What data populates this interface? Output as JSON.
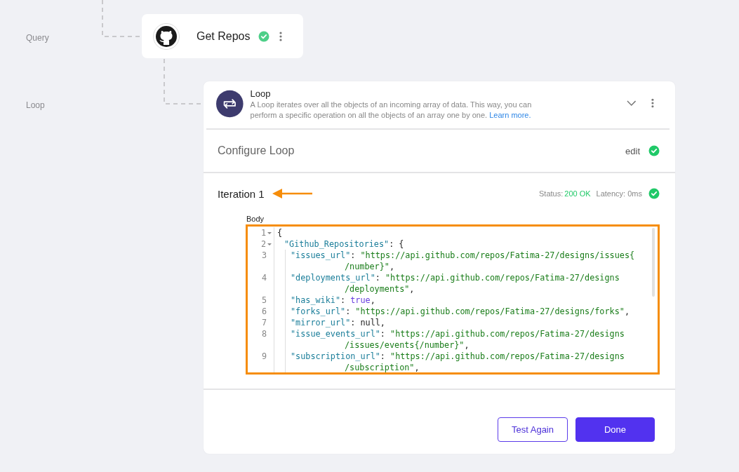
{
  "canvas": {
    "stage_labels": [
      "Query",
      "Loop"
    ]
  },
  "query_node": {
    "title": "Get Repos",
    "success": true
  },
  "loop_panel": {
    "title": "Loop",
    "description": "A Loop iterates over all the objects of an incoming array of data. This way, you can perform a specific operation on all the objects of an array one by one.",
    "link": "Learn more.",
    "configure": {
      "title": "Configure Loop",
      "action": "edit",
      "success": true
    },
    "iteration": {
      "title": "Iteration 1",
      "status_label": "Status:",
      "status_value": "200 OK",
      "latency": "Latency: 0ms",
      "success": true,
      "highlighted": true,
      "body_label": "Body",
      "code": [
        {
          "number": "1",
          "folded": false,
          "tokens": [
            {
              "kind": "punct",
              "text": "{"
            }
          ],
          "children": [
            {
              "number": "2",
              "folded": false,
              "tokens": [
                {
                  "kind": "key",
                  "text": "\"Github_Repositories\""
                },
                {
                  "kind": "punct",
                  "text": ": {"
                }
              ],
              "children": [
                {
                  "number": "3",
                  "tokens": [
                    {
                      "kind": "key",
                      "text": "\"issues_url\""
                    },
                    {
                      "kind": "punct",
                      "text": ": "
                    },
                    {
                      "kind": "string",
                      "text": "\"https://api.github.com/repos/Fatima-27/designs/issues{"
                    }
                  ],
                  "wrap": [
                    {
                      "kind": "string",
                      "text": "/number}\""
                    },
                    {
                      "kind": "punct",
                      "text": ","
                    }
                  ]
                },
                {
                  "number": "4",
                  "tokens": [
                    {
                      "kind": "key",
                      "text": "\"deployments_url\""
                    },
                    {
                      "kind": "punct",
                      "text": ": "
                    },
                    {
                      "kind": "string",
                      "text": "\"https://api.github.com/repos/Fatima-27/designs"
                    }
                  ],
                  "wrap": [
                    {
                      "kind": "string",
                      "text": "/deployments\""
                    },
                    {
                      "kind": "punct",
                      "text": ","
                    }
                  ]
                },
                {
                  "number": "5",
                  "tokens": [
                    {
                      "kind": "key",
                      "text": "\"has_wiki\""
                    },
                    {
                      "kind": "punct",
                      "text": ": "
                    },
                    {
                      "kind": "keyword",
                      "text": "true"
                    },
                    {
                      "kind": "punct",
                      "text": ","
                    }
                  ]
                },
                {
                  "number": "6",
                  "tokens": [
                    {
                      "kind": "key",
                      "text": "\"forks_url\""
                    },
                    {
                      "kind": "punct",
                      "text": ": "
                    },
                    {
                      "kind": "string",
                      "text": "\"https://api.github.com/repos/Fatima-27/designs/forks\""
                    },
                    {
                      "kind": "punct",
                      "text": ","
                    }
                  ]
                },
                {
                  "number": "7",
                  "tokens": [
                    {
                      "kind": "key",
                      "text": "\"mirror_url\""
                    },
                    {
                      "kind": "punct",
                      "text": ": null,"
                    }
                  ]
                },
                {
                  "number": "8",
                  "tokens": [
                    {
                      "kind": "key",
                      "text": "\"issue_events_url\""
                    },
                    {
                      "kind": "punct",
                      "text": ": "
                    },
                    {
                      "kind": "string",
                      "text": "\"https://api.github.com/repos/Fatima-27/designs"
                    }
                  ],
                  "wrap": [
                    {
                      "kind": "string",
                      "text": "/issues/events{/number}\""
                    },
                    {
                      "kind": "punct",
                      "text": ","
                    }
                  ]
                },
                {
                  "number": "9",
                  "tokens": [
                    {
                      "kind": "key",
                      "text": "\"subscription_url\""
                    },
                    {
                      "kind": "punct",
                      "text": ": "
                    },
                    {
                      "kind": "string",
                      "text": "\"https://api.github.com/repos/Fatima-27/designs"
                    }
                  ],
                  "wrap": [
                    {
                      "kind": "string",
                      "text": "/subscription\""
                    },
                    {
                      "kind": "punct",
                      "text": ","
                    }
                  ]
                }
              ]
            }
          ]
        }
      ]
    },
    "buttons": [
      {
        "label": "Test Again",
        "kind": "secondary"
      },
      {
        "label": "Done",
        "kind": "primary"
      }
    ]
  }
}
